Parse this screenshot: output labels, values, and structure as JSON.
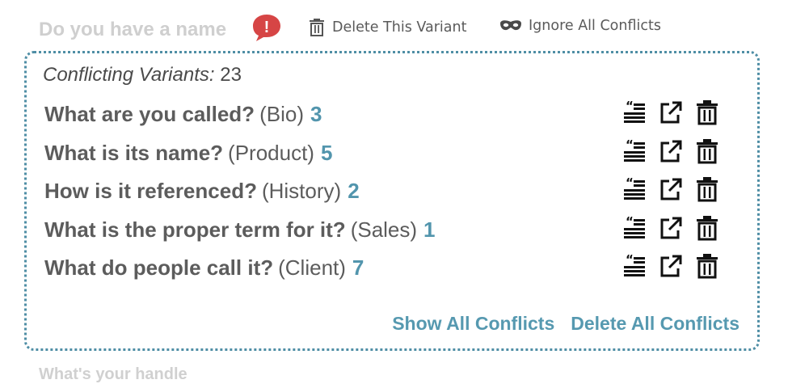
{
  "top": {
    "question_title": "Do you have a name",
    "alert_symbol": "!",
    "delete_variant_label": "Delete This Variant",
    "ignore_conflicts_label": "Ignore All Conflicts"
  },
  "panel": {
    "conflicting_label": "Conflicting Variants:",
    "conflicting_count": "23",
    "variants": [
      {
        "question": "What are you called?",
        "category": "(Bio)",
        "count": "3"
      },
      {
        "question": "What is its name?",
        "category": "(Product)",
        "count": "5"
      },
      {
        "question": "How is it referenced?",
        "category": "(History)",
        "count": "2"
      },
      {
        "question": "What is the proper term for it?",
        "category": "(Sales)",
        "count": "1"
      },
      {
        "question": "What do people call it?",
        "category": "(Client)",
        "count": "7"
      }
    ],
    "row_icons": [
      "quote-list-icon",
      "external-link-icon",
      "trash-icon"
    ],
    "show_all_label": "Show All Conflicts",
    "delete_all_label": "Delete All Conflicts"
  },
  "next_question": "What's your handle",
  "colors": {
    "accent": "#5295ad",
    "panel_border": "#4f8ea5",
    "alert": "#d64545",
    "faded_text": "#cfcfcf"
  }
}
